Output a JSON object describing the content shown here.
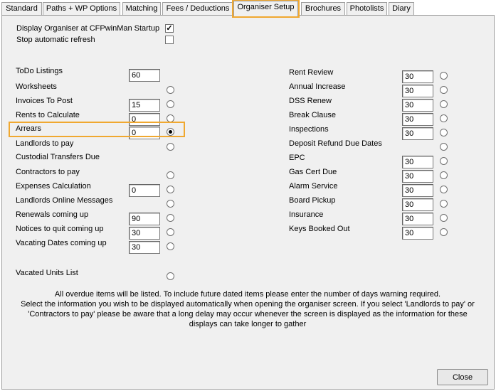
{
  "tabs": [
    {
      "label": "Standard"
    },
    {
      "label": "Paths + WP Options"
    },
    {
      "label": "Matching"
    },
    {
      "label": "Fees / Deductions"
    },
    {
      "label": "Organiser Setup",
      "active": true
    },
    {
      "label": "Brochures"
    },
    {
      "label": "Photolists"
    },
    {
      "label": "Diary"
    }
  ],
  "options": {
    "display_startup": {
      "label": "Display Organiser at CFPwinMan Startup",
      "checked": true,
      "mark": "✓"
    },
    "stop_refresh": {
      "label": "Stop automatic refresh",
      "checked": false,
      "mark": ""
    }
  },
  "left_items": [
    {
      "label": "ToDo Listings",
      "value": "60",
      "has_input": true,
      "has_radio": false,
      "selected": false
    },
    {
      "label": "Worksheets",
      "value": "",
      "has_input": false,
      "has_radio": true,
      "selected": false
    },
    {
      "label": "Invoices To Post",
      "value": "15",
      "has_input": true,
      "has_radio": true,
      "selected": false
    },
    {
      "label": "Rents to Calculate",
      "value": "0",
      "has_input": true,
      "has_radio": true,
      "selected": false
    },
    {
      "label": "Arrears",
      "value": "0",
      "has_input": true,
      "has_radio": true,
      "selected": true
    },
    {
      "label": "Landlords to pay",
      "value": "",
      "has_input": false,
      "has_radio": true,
      "selected": false
    },
    {
      "label": "Custodial Transfers Due",
      "value": "",
      "has_input": false,
      "has_radio": false,
      "selected": false
    },
    {
      "label": "Contractors to pay",
      "value": "",
      "has_input": false,
      "has_radio": true,
      "selected": false
    },
    {
      "label": "Expenses Calculation",
      "value": "0",
      "has_input": true,
      "has_radio": true,
      "selected": false
    },
    {
      "label": "Landlords Online Messages",
      "value": "",
      "has_input": false,
      "has_radio": true,
      "selected": false
    },
    {
      "label": "Renewals coming up",
      "value": "90",
      "has_input": true,
      "has_radio": true,
      "selected": false
    },
    {
      "label": "Notices to quit coming up",
      "value": "30",
      "has_input": true,
      "has_radio": true,
      "selected": false
    },
    {
      "label": "Vacating Dates coming up",
      "value": "30",
      "has_input": true,
      "has_radio": true,
      "selected": false
    },
    {
      "label": "Vacated Units List",
      "value": "",
      "has_input": false,
      "has_radio": true,
      "selected": false
    }
  ],
  "right_items": [
    {
      "label": "Rent Review",
      "value": "30",
      "has_input": true,
      "has_radio": true,
      "selected": false
    },
    {
      "label": "Annual Increase",
      "value": "30",
      "has_input": true,
      "has_radio": true,
      "selected": false
    },
    {
      "label": "DSS Renew",
      "value": "30",
      "has_input": true,
      "has_radio": true,
      "selected": false
    },
    {
      "label": "Break Clause",
      "value": "30",
      "has_input": true,
      "has_radio": true,
      "selected": false
    },
    {
      "label": "Inspections",
      "value": "30",
      "has_input": true,
      "has_radio": true,
      "selected": false
    },
    {
      "label": "Deposit Refund Due Dates",
      "value": "",
      "has_input": false,
      "has_radio": true,
      "selected": false
    },
    {
      "label": "EPC",
      "value": "30",
      "has_input": true,
      "has_radio": true,
      "selected": false
    },
    {
      "label": "Gas Cert Due",
      "value": "30",
      "has_input": true,
      "has_radio": true,
      "selected": false
    },
    {
      "label": "Alarm Service",
      "value": "30",
      "has_input": true,
      "has_radio": true,
      "selected": false
    },
    {
      "label": "Board Pickup",
      "value": "30",
      "has_input": true,
      "has_radio": true,
      "selected": false
    },
    {
      "label": "Insurance",
      "value": "30",
      "has_input": true,
      "has_radio": true,
      "selected": false
    },
    {
      "label": "Keys Booked Out",
      "value": "30",
      "has_input": true,
      "has_radio": true,
      "selected": false
    }
  ],
  "info": {
    "line1": "All overdue items will be listed. To include future dated items please enter the number of days warning required.",
    "line2": "Select the information you wish to be displayed automatically when opening the organiser screen.  If you select 'Landlords to pay' or",
    "line3": "'Contractors to pay' please be aware that a long delay may occur whenever the screen is displayed as the information for these",
    "line4": "displays can take longer to gather"
  },
  "buttons": {
    "close": "Close"
  },
  "colors": {
    "highlight": "#f0a830",
    "panel": "#f0f0f0"
  }
}
